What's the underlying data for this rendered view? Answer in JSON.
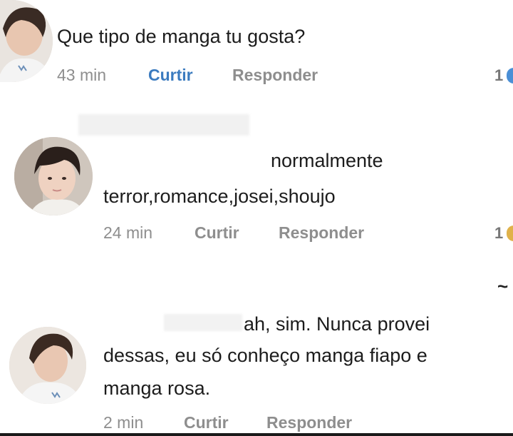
{
  "comments": [
    {
      "text": "Que tipo de manga tu gosta?",
      "time": "43 min",
      "like_label": "Curtir",
      "reply_label": "Responder",
      "like_count": "1"
    },
    {
      "text_line1": "normalmente",
      "text_line2": "terror,romance,josei,shoujo",
      "time": "24 min",
      "like_label": "Curtir",
      "reply_label": "Responder",
      "like_count": "1"
    },
    {
      "text_line1": "ah, sim. Nunca provei",
      "text_line2": "dessas, eu só conheço manga fiapo e",
      "text_line3": "manga rosa.",
      "time": "2 min",
      "like_label": "Curtir",
      "reply_label": "Responder"
    }
  ],
  "colors": {
    "like_active": "#3b7bbf",
    "meta_gray": "#8e8e8e",
    "heart_blue": "#4a8fd6",
    "heart_yellow": "#e0b24a"
  }
}
